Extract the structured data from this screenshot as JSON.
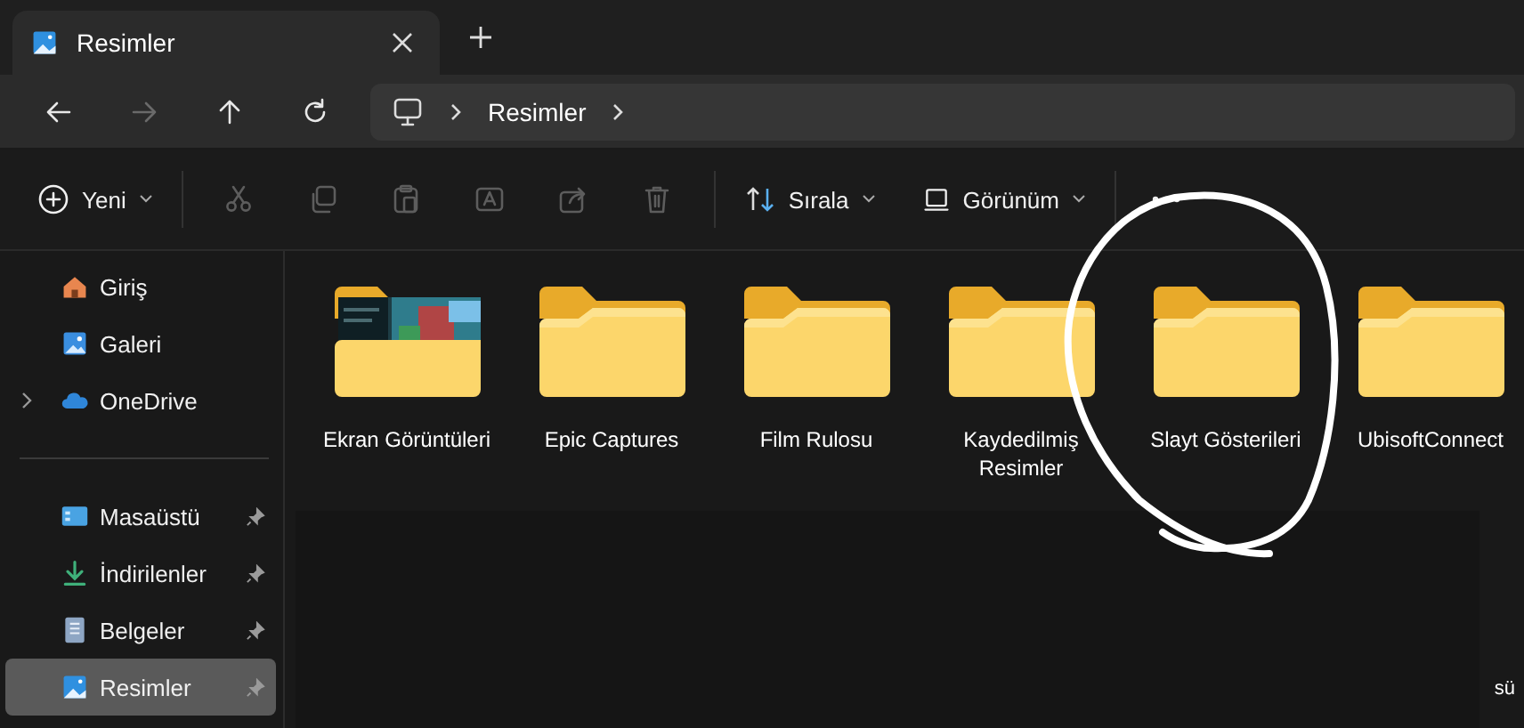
{
  "tabs": [
    {
      "title": "Resimler",
      "selected": true
    }
  ],
  "nav": {
    "buttons": [
      {
        "kind": "back",
        "disabled": false
      },
      {
        "kind": "forward",
        "disabled": true
      },
      {
        "kind": "up",
        "disabled": false
      },
      {
        "kind": "refresh",
        "disabled": false
      }
    ],
    "path": [
      "Resimler"
    ]
  },
  "commands": {
    "new": "Yeni",
    "tools": [
      {
        "kind": "cut",
        "disabled": true
      },
      {
        "kind": "copy",
        "disabled": true
      },
      {
        "kind": "paste",
        "disabled": true
      },
      {
        "kind": "rename",
        "disabled": true
      },
      {
        "kind": "share",
        "disabled": true
      },
      {
        "kind": "delete",
        "disabled": true
      }
    ],
    "sort": "Sırala",
    "view": "Görünüm"
  },
  "sidebar": {
    "top": [
      {
        "label": "Giriş",
        "kind": "home",
        "expandable": false,
        "selected": false
      },
      {
        "label": "Galeri",
        "kind": "gallery",
        "expandable": false,
        "selected": false
      },
      {
        "label": "OneDrive",
        "kind": "cloud",
        "expandable": true,
        "selected": false
      }
    ],
    "pinned": [
      {
        "label": "Masaüstü",
        "kind": "desktop",
        "pinned": true,
        "selected": false
      },
      {
        "label": "İndirilenler",
        "kind": "download",
        "pinned": true,
        "selected": false
      },
      {
        "label": "Belgeler",
        "kind": "documents",
        "pinned": true,
        "selected": false
      },
      {
        "label": "Resimler",
        "kind": "pictures",
        "pinned": true,
        "selected": true
      }
    ]
  },
  "folders": [
    {
      "name": "Ekran Görüntüleri",
      "kind": "preview"
    },
    {
      "name": "Epic Captures",
      "kind": "folder"
    },
    {
      "name": "Film Rulosu",
      "kind": "folder"
    },
    {
      "name": "Kaydedilmiş Resimler",
      "kind": "folder"
    },
    {
      "name": "Slayt Gösterileri",
      "kind": "folder"
    },
    {
      "name": "UbisoftConnect",
      "kind": "folder"
    }
  ],
  "annotation": {
    "kind": "circle"
  },
  "fragment": "sü"
}
